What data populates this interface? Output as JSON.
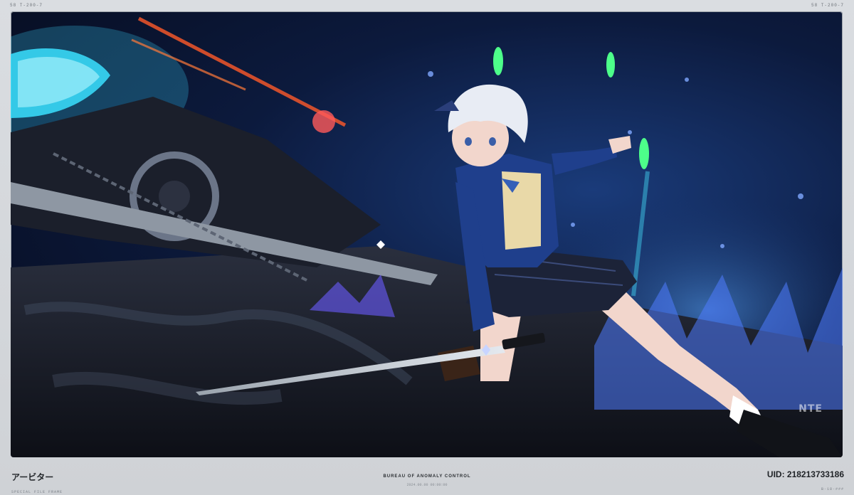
{
  "header": {
    "left_code": "58  T-200-7",
    "right_code": "58  T-200-7"
  },
  "photo": {
    "icon": "anime-character-artwork",
    "watermark": "NTE"
  },
  "footer": {
    "character_name": "アービター",
    "left_subtag": "SPECIAL FILE FRAME",
    "organization": "BUREAU OF ANOMALY CONTROL",
    "timestamp": "2024.00.00 00:00:00",
    "uid": "UID: 218213733186",
    "right_subtag": "B-18-###"
  },
  "colors": {
    "frame": "#d2d5d9",
    "scene_dark": "#060b1c",
    "scene_blue": "#1a3b7a",
    "accent_cyan": "#4fd8ff",
    "accent_green": "#4dff8a"
  }
}
